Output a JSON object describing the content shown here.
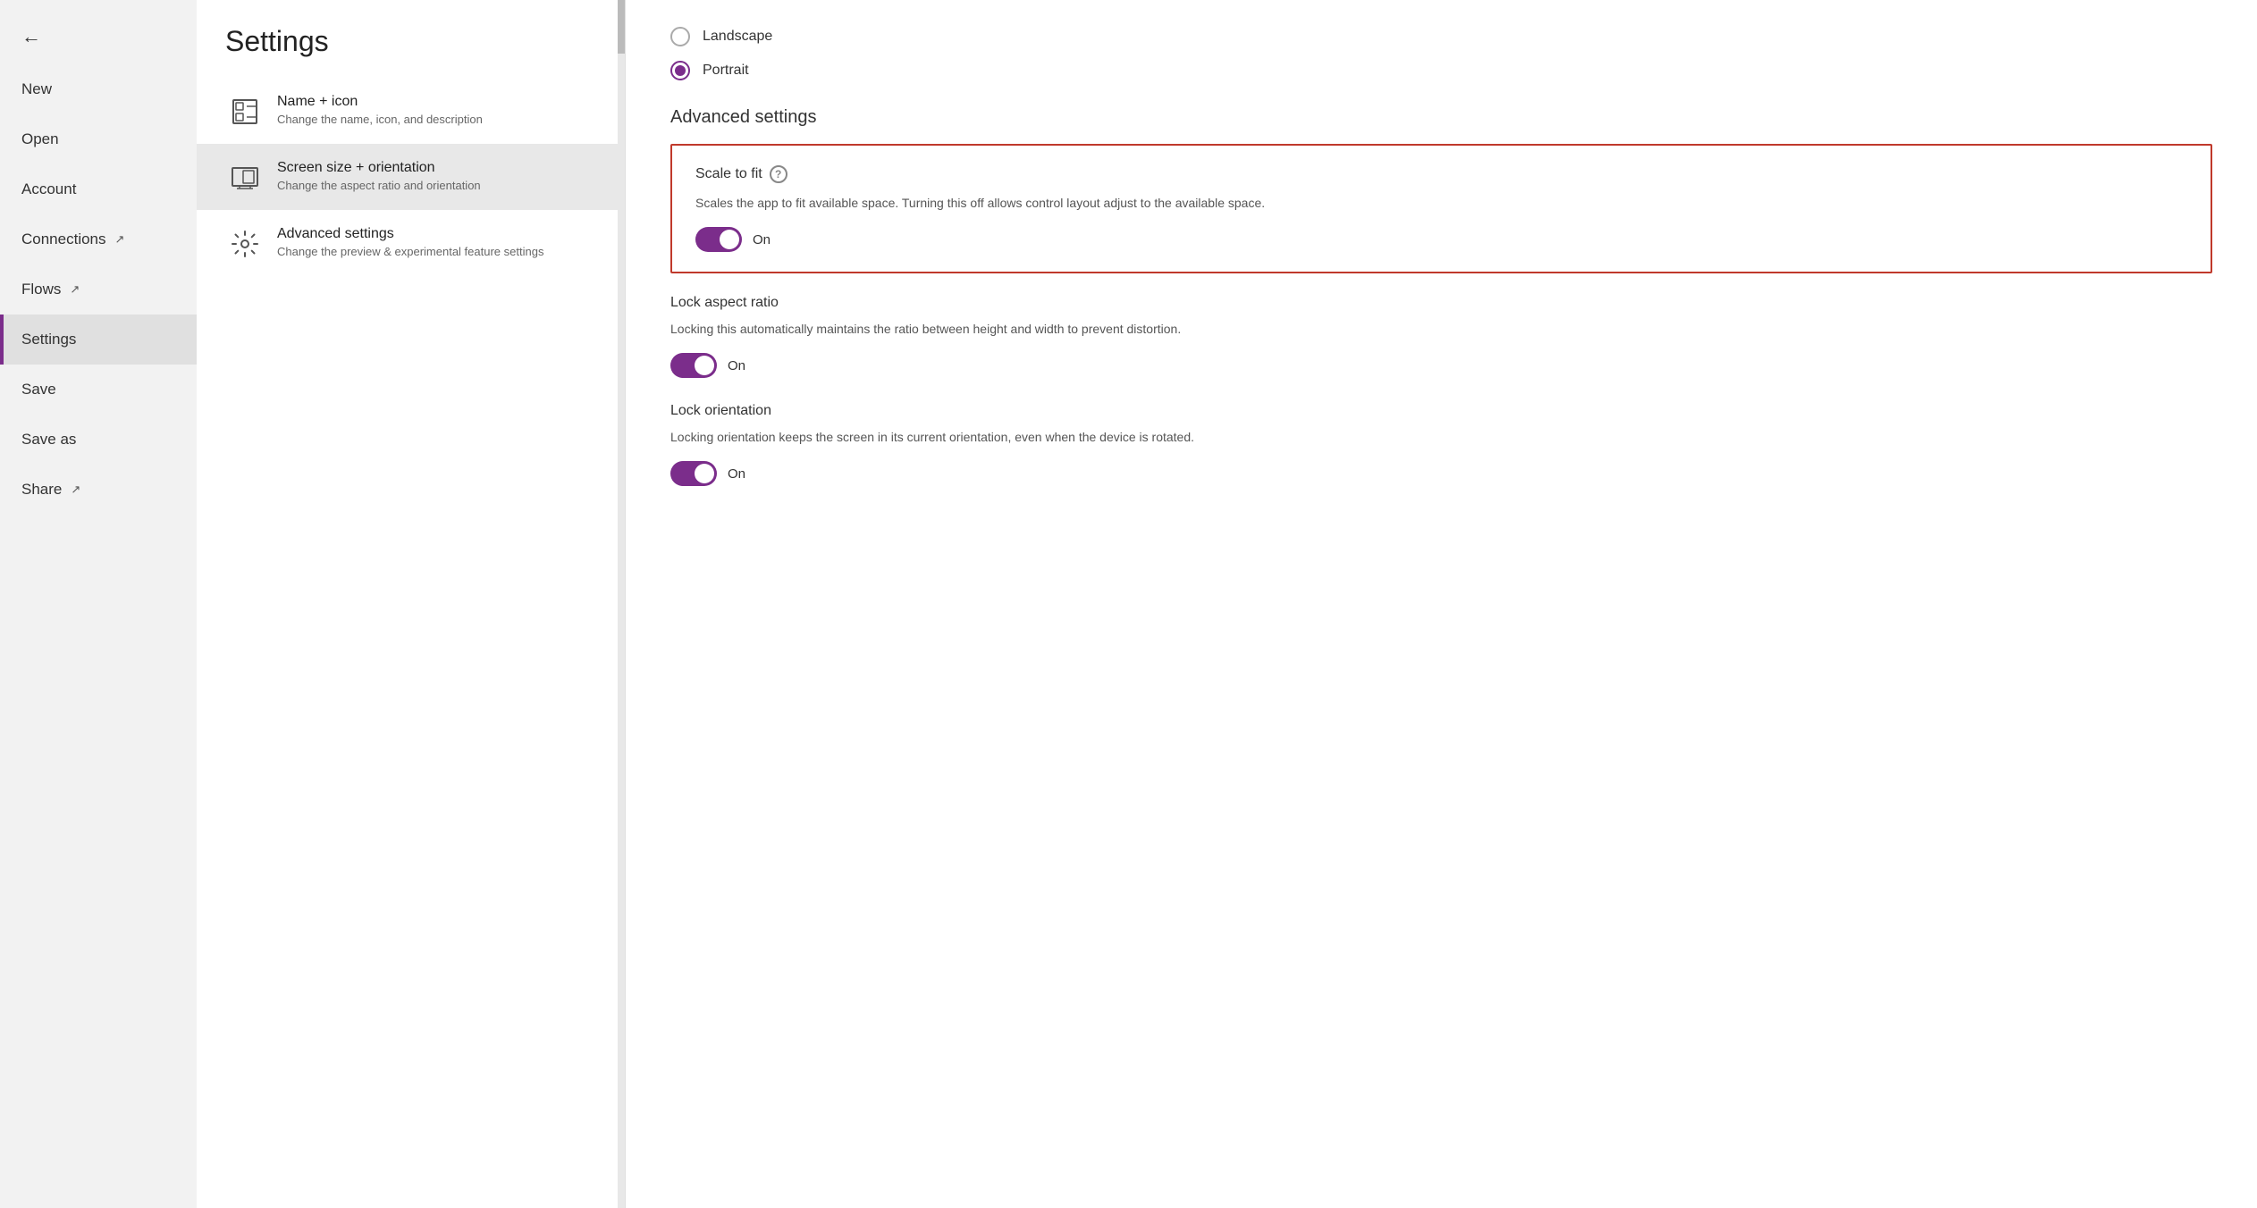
{
  "sidebar": {
    "back_icon": "←",
    "items": [
      {
        "label": "New",
        "active": false,
        "has_ext": false
      },
      {
        "label": "Open",
        "active": false,
        "has_ext": false
      },
      {
        "label": "Account",
        "active": false,
        "has_ext": false
      },
      {
        "label": "Connections",
        "active": false,
        "has_ext": true
      },
      {
        "label": "Flows",
        "active": false,
        "has_ext": true
      },
      {
        "label": "Settings",
        "active": true,
        "has_ext": false
      },
      {
        "label": "Save",
        "active": false,
        "has_ext": false
      },
      {
        "label": "Save as",
        "active": false,
        "has_ext": false
      },
      {
        "label": "Share",
        "active": false,
        "has_ext": true
      }
    ]
  },
  "settings": {
    "title": "Settings",
    "nav_items": [
      {
        "id": "name-icon",
        "label": "Name + icon",
        "desc": "Change the name, icon, and description",
        "active": false
      },
      {
        "id": "screen-size",
        "label": "Screen size + orientation",
        "desc": "Change the aspect ratio and orientation",
        "active": true
      },
      {
        "id": "advanced",
        "label": "Advanced settings",
        "desc": "Change the preview & experimental feature settings",
        "active": false
      }
    ]
  },
  "content": {
    "orientation": {
      "landscape_label": "Landscape",
      "portrait_label": "Portrait",
      "selected": "portrait"
    },
    "advanced_settings_title": "Advanced settings",
    "scale_to_fit": {
      "title": "Scale to fit",
      "desc": "Scales the app to fit available space. Turning this off allows control layout adjust to the available space.",
      "state": "On",
      "enabled": true
    },
    "lock_aspect_ratio": {
      "title": "Lock aspect ratio",
      "desc": "Locking this automatically maintains the ratio between height and width to prevent distortion.",
      "state": "On",
      "enabled": true
    },
    "lock_orientation": {
      "title": "Lock orientation",
      "desc": "Locking orientation keeps the screen in its current orientation, even when the device is rotated.",
      "state": "On",
      "enabled": true
    }
  }
}
